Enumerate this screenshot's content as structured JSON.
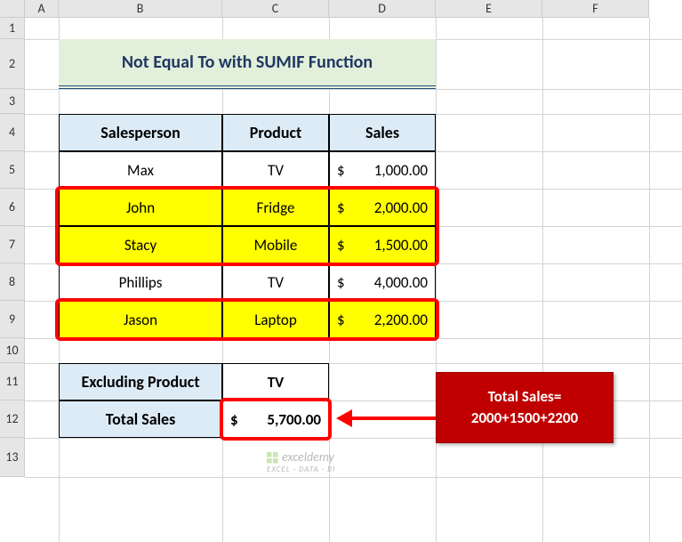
{
  "columns": [
    "A",
    "B",
    "C",
    "D",
    "E",
    "F"
  ],
  "rows": [
    "1",
    "2",
    "3",
    "4",
    "5",
    "6",
    "7",
    "8",
    "9",
    "10",
    "11",
    "12",
    "13"
  ],
  "colX": [
    28,
    66,
    250,
    370,
    490,
    610,
    730
  ],
  "rowY": [
    20,
    44,
    100,
    128,
    170,
    212,
    254,
    296,
    338,
    380,
    408,
    450,
    492,
    536
  ],
  "title": "Not Equal To with SUMIF Function",
  "headers": {
    "salesperson": "Salesperson",
    "product": "Product",
    "sales": "Sales"
  },
  "table": [
    {
      "name": "Max",
      "product": "TV",
      "sales": "1,000.00",
      "hl": false
    },
    {
      "name": "John",
      "product": "Fridge",
      "sales": "2,000.00",
      "hl": true
    },
    {
      "name": "Stacy",
      "product": "Mobile",
      "sales": "1,500.00",
      "hl": true
    },
    {
      "name": "Phillips",
      "product": "TV",
      "sales": "4,000.00",
      "hl": false
    },
    {
      "name": "Jason",
      "product": "Laptop",
      "sales": "2,200.00",
      "hl": true
    }
  ],
  "summary": {
    "excludingLabel": "Excluding Product",
    "excludingValue": "TV",
    "totalLabel": "Total Sales",
    "totalValue": "5,700.00"
  },
  "callout": {
    "line1": "Total Sales=",
    "line2": "2000+1500+2200"
  },
  "watermark": {
    "main": "exceldemy",
    "sub": "EXCEL · DATA · BI"
  },
  "currency": "$"
}
